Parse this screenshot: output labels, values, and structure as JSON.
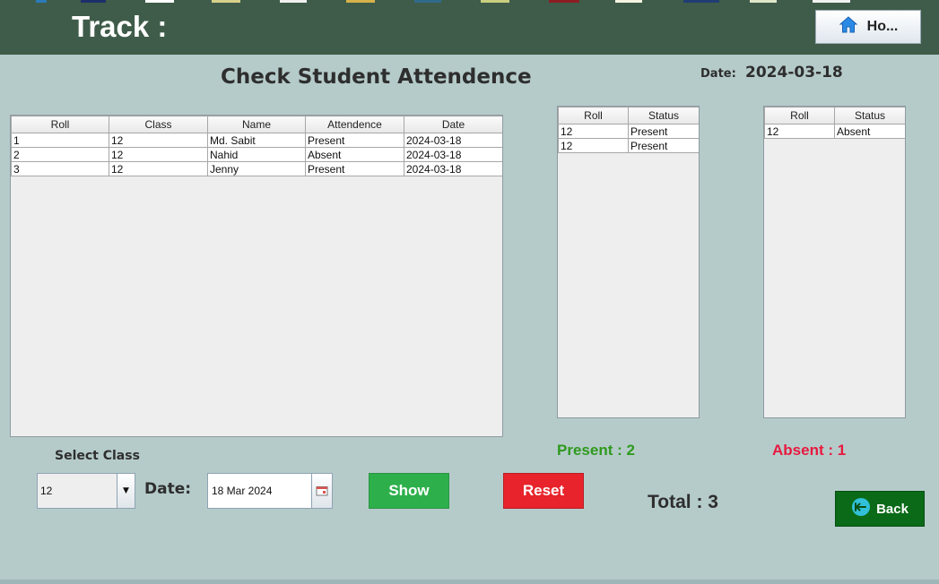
{
  "header": {
    "title": "Track :",
    "home_label": "Ho..."
  },
  "page": {
    "title": "Check Student Attendence",
    "date_label": "Date:",
    "date_value": "2024-03-18"
  },
  "main_table": {
    "columns": [
      "Roll",
      "Class",
      "Name",
      "Attendence",
      "Date"
    ],
    "rows": [
      [
        "1",
        "12",
        "Md. Sabit",
        "Present",
        "2024-03-18"
      ],
      [
        "2",
        "12",
        "Nahid",
        "Absent",
        "2024-03-18"
      ],
      [
        "3",
        "12",
        "Jenny",
        "Present",
        "2024-03-18"
      ]
    ]
  },
  "present_table": {
    "columns": [
      "Roll",
      "Status"
    ],
    "rows": [
      [
        "12",
        "Present"
      ],
      [
        "12",
        "Present"
      ]
    ]
  },
  "absent_table": {
    "columns": [
      "Roll",
      "Status"
    ],
    "rows": [
      [
        "12",
        "Absent"
      ]
    ]
  },
  "counts": {
    "present": "Present : 2",
    "absent": "Absent : 1",
    "total": "Total : 3"
  },
  "controls": {
    "select_class_label": "Select Class",
    "class_value": "12",
    "date_label": "Date:",
    "date_value": "18 Mar 2024",
    "show_label": "Show",
    "reset_label": "Reset",
    "back_label": "Back"
  },
  "colors": {
    "header_bg": "#3f5c4a",
    "body_bg": "#b5cbca",
    "show_button": "#2db04b",
    "reset_button": "#e8232c",
    "back_button": "#0a6a17",
    "present_text": "#2f9a1d",
    "absent_text": "#e8193f"
  },
  "icons": {
    "home": "home-icon",
    "back": "back-arrow-icon",
    "dropdown": "chevron-down-icon",
    "calendar": "calendar-icon"
  }
}
